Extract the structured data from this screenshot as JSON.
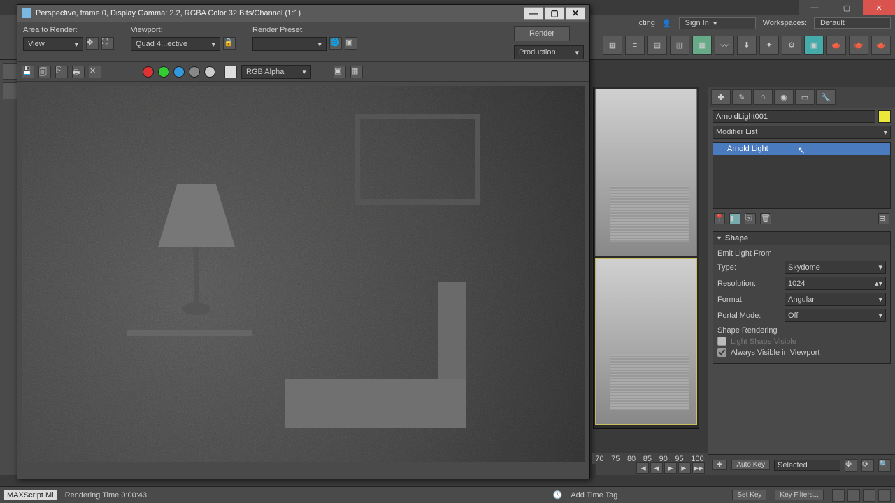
{
  "parent_win": {
    "sign_in": "Sign In",
    "workspaces_label": "Workspaces:",
    "workspace": "Default"
  },
  "render_win": {
    "title": "Perspective, frame 0, Display Gamma: 2.2, RGBA Color 32 Bits/Channel (1:1)",
    "area_label": "Area to Render:",
    "area_value": "View",
    "viewport_label": "Viewport:",
    "viewport_value": "Quad 4...ective",
    "preset_label": "Render Preset:",
    "preset_value": "",
    "render_btn": "Render",
    "mode": "Production",
    "channel_sel": "RGB Alpha"
  },
  "cmd_panel": {
    "object_name": "ArnoldLight001",
    "modifier_list": "Modifier List",
    "stack_item": "Arnold Light",
    "rollout_shape": "Shape",
    "emit_from": "Emit Light From",
    "type_label": "Type:",
    "type_value": "Skydome",
    "res_label": "Resolution:",
    "res_value": "1024",
    "format_label": "Format:",
    "format_value": "Angular",
    "portal_label": "Portal Mode:",
    "portal_value": "Off",
    "shape_rendering": "Shape Rendering",
    "light_shape_visible": "Light Shape Visible",
    "always_visible": "Always Visible in Viewport"
  },
  "timeline": {
    "ticks": [
      "70",
      "75",
      "80",
      "85",
      "90",
      "95",
      "100"
    ]
  },
  "bottom": {
    "autokey": "Auto Key",
    "selected": "Selected",
    "setkey": "Set Key",
    "keyfilters": "Key Filters..."
  },
  "status": {
    "maxscript": "MAXScript Mi",
    "render_time": "Rendering Time 0:00:43",
    "add_tag": "Add Time Tag"
  }
}
